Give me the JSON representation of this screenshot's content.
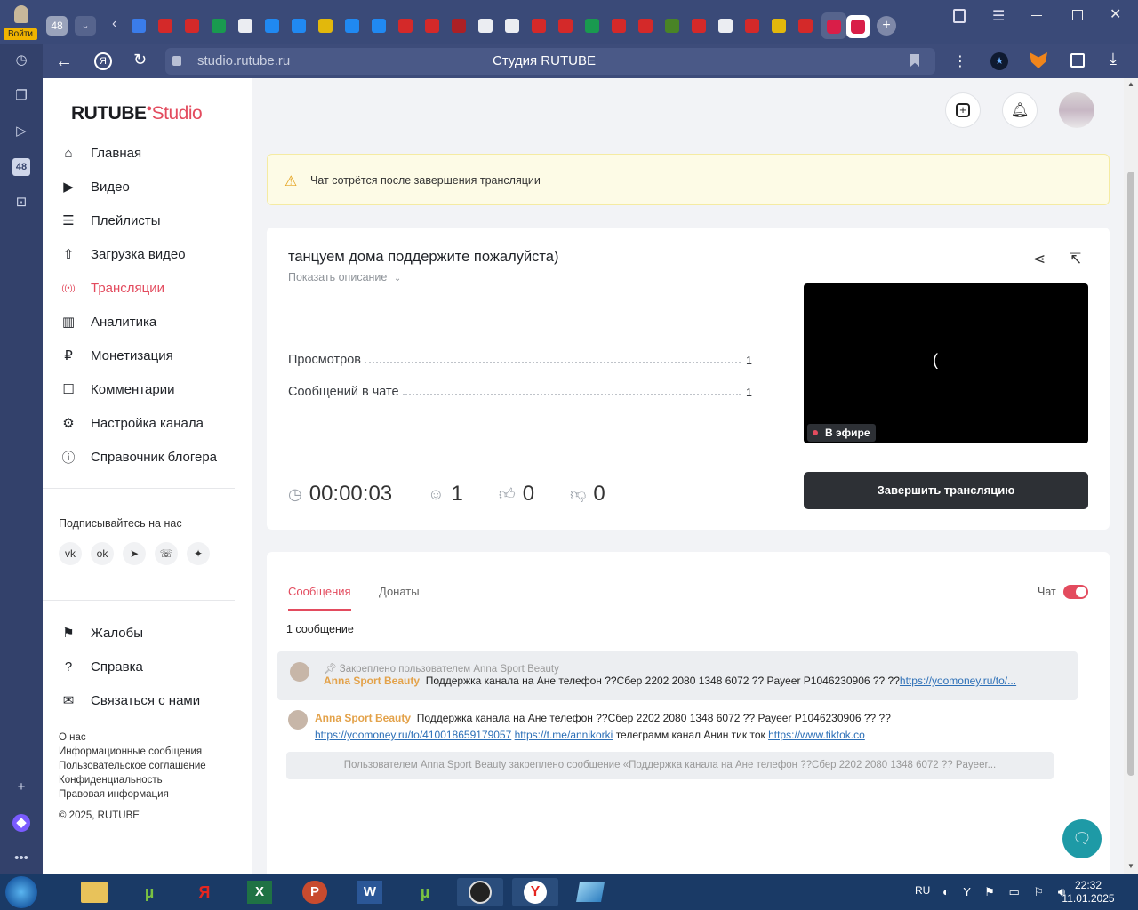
{
  "browser": {
    "profile_label": "Войти",
    "tab_count": "48",
    "url": "studio.rutube.ru",
    "page_title": "Студия RUTUBE"
  },
  "logo": {
    "rutube": "RUTUBE",
    "studio": "Studio"
  },
  "sidebar": {
    "items": [
      {
        "label": "Главная",
        "icon": "home-icon"
      },
      {
        "label": "Видео",
        "icon": "video-icon"
      },
      {
        "label": "Плейлисты",
        "icon": "playlist-icon"
      },
      {
        "label": "Загрузка видео",
        "icon": "upload-icon"
      },
      {
        "label": "Трансляции",
        "icon": "broadcast-icon"
      },
      {
        "label": "Аналитика",
        "icon": "analytics-icon"
      },
      {
        "label": "Монетизация",
        "icon": "ruble-icon"
      },
      {
        "label": "Комментарии",
        "icon": "comment-icon"
      },
      {
        "label": "Настройка канала",
        "icon": "gear-icon"
      },
      {
        "label": "Справочник блогера",
        "icon": "info-icon"
      }
    ],
    "follow_label": "Подписывайтесь на нас",
    "social": [
      "vk-icon",
      "ok-icon",
      "telegram-icon",
      "viber-icon",
      "more-icon"
    ],
    "bottom_items": [
      {
        "label": "Жалобы",
        "icon": "flag-icon"
      },
      {
        "label": "Справка",
        "icon": "help-icon"
      },
      {
        "label": "Связаться с нами",
        "icon": "mail-icon"
      }
    ],
    "links": [
      "О нас",
      "Информационные сообщения",
      "Пользовательское соглашение",
      "Конфиденциальность",
      "Правовая информация"
    ],
    "copyright": "© 2025, RUTUBE"
  },
  "notice": {
    "text": "Чат сотрётся после завершения трансляции"
  },
  "stream": {
    "title": "танцуем дома поддержите пожалуйста)",
    "show_description": "Показать описание",
    "views_label": "Просмотров",
    "views_value": "1",
    "chat_msgs_label": "Сообщений в чате",
    "chat_msgs_value": "1",
    "live_label": "В эфире",
    "timer": "00:00:03",
    "viewers": "1",
    "likes": "0",
    "dislikes": "0",
    "end_button": "Завершить трансляцию"
  },
  "chat": {
    "tabs": [
      "Сообщения",
      "Донаты"
    ],
    "toggle_label": "Чат",
    "count_label": "1 сообщение",
    "pinned_header": "Закреплено пользователем Anna Sport Beauty",
    "pinned_author": "Anna Sport Beauty",
    "pinned_text": "Поддержка канала на Ане телефон ??Сбер 2202 2080 1348 6072 ?? Payeer P1046230906 ?? ??",
    "pinned_link": "https://yoomoney.ru/to/...",
    "msg_author": "Anna Sport Beauty",
    "msg_text": "Поддержка канала на Ане телефон ??Сбер 2202 2080 1348 6072 ?? Payeer P1046230906 ?? ??",
    "msg_link1": "https://yoomoney.ru/to/410018659179057",
    "msg_link2": "https://t.me/annikorki",
    "msg_mid": "телеграмм канал Анин тик ток",
    "msg_link3": "https://www.tiktok.co",
    "system_msg": "Пользователем Anna Sport Beauty закреплено сообщение «Поддержка канала на Ане телефон ??Сбер 2202 2080 1348 6072 ?? Payeer..."
  },
  "taskbar": {
    "lang": "RU",
    "time": "22:32",
    "date": "11.01.2025"
  },
  "colors": {
    "accent": "#e34b5e",
    "dark_button": "#2d3035",
    "notice_bg": "#fdfbe6",
    "teal": "#1e9aa6"
  }
}
